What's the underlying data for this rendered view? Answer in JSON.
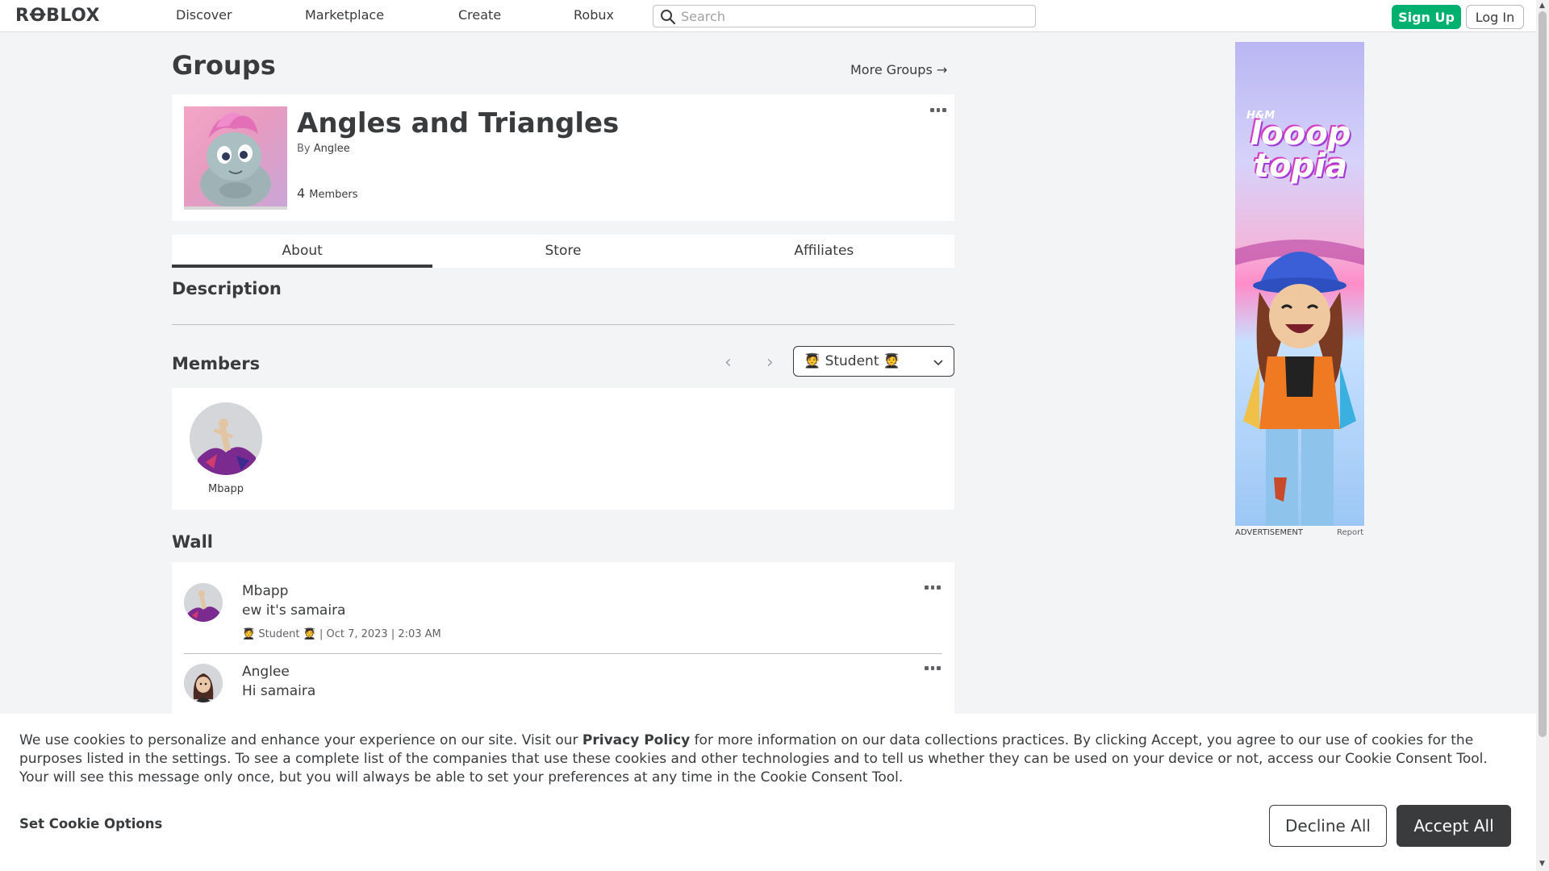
{
  "topbar": {
    "logo": "RꝊBLOX",
    "nav": [
      "Discover",
      "Marketplace",
      "Create",
      "Robux"
    ],
    "search_placeholder": "Search",
    "signup_label": "Sign Up",
    "login_label": "Log In"
  },
  "page": {
    "title": "Groups",
    "more_groups": "More Groups →"
  },
  "group": {
    "name": "Angles and Triangles",
    "by_prefix": "By",
    "owner": "Anglee",
    "member_count": "4",
    "member_label": "Members"
  },
  "tabs": [
    "About",
    "Store",
    "Affiliates"
  ],
  "description": {
    "title": "Description"
  },
  "members": {
    "title": "Members",
    "prev_arrow": "‹",
    "next_arrow": "›",
    "role_selected": "🧑‍🎓 Student 🧑‍🎓",
    "list": [
      {
        "name": "Mbapp"
      }
    ]
  },
  "wall": {
    "title": "Wall",
    "posts": [
      {
        "author": "Mbapp",
        "body": "ew it's samaira",
        "meta": "🧑‍🎓 Student 🧑‍🎓 | Oct 7, 2023 | 2:03 AM"
      },
      {
        "author": "Anglee",
        "body": "Hi samaira"
      }
    ]
  },
  "ad": {
    "brand": "H&M",
    "logo_line1": "looop",
    "logo_line2": "topia",
    "label": "ADVERTISEMENT",
    "report": "Report"
  },
  "cookie": {
    "text_before": "We use cookies to personalize and enhance your experience on our site. Visit our ",
    "link": "Privacy Policy",
    "text_after": " for more information on our data collections practices. By clicking Accept, you agree to our use of cookies for the purposes listed in the settings. To see a complete list of the companies that use these cookies and other technologies and to tell us whether they can be used on your device or not, access our Cookie Consent Tool. Your will see this message only once, but you will always be able to set your preferences at any time in the Cookie Consent Tool.",
    "options": "Set Cookie Options",
    "decline": "Decline All",
    "accept": "Accept All"
  },
  "colors": {
    "accent_green": "#00b06f",
    "text_dark": "#393b3d",
    "page_bg": "#f2f4f5"
  }
}
